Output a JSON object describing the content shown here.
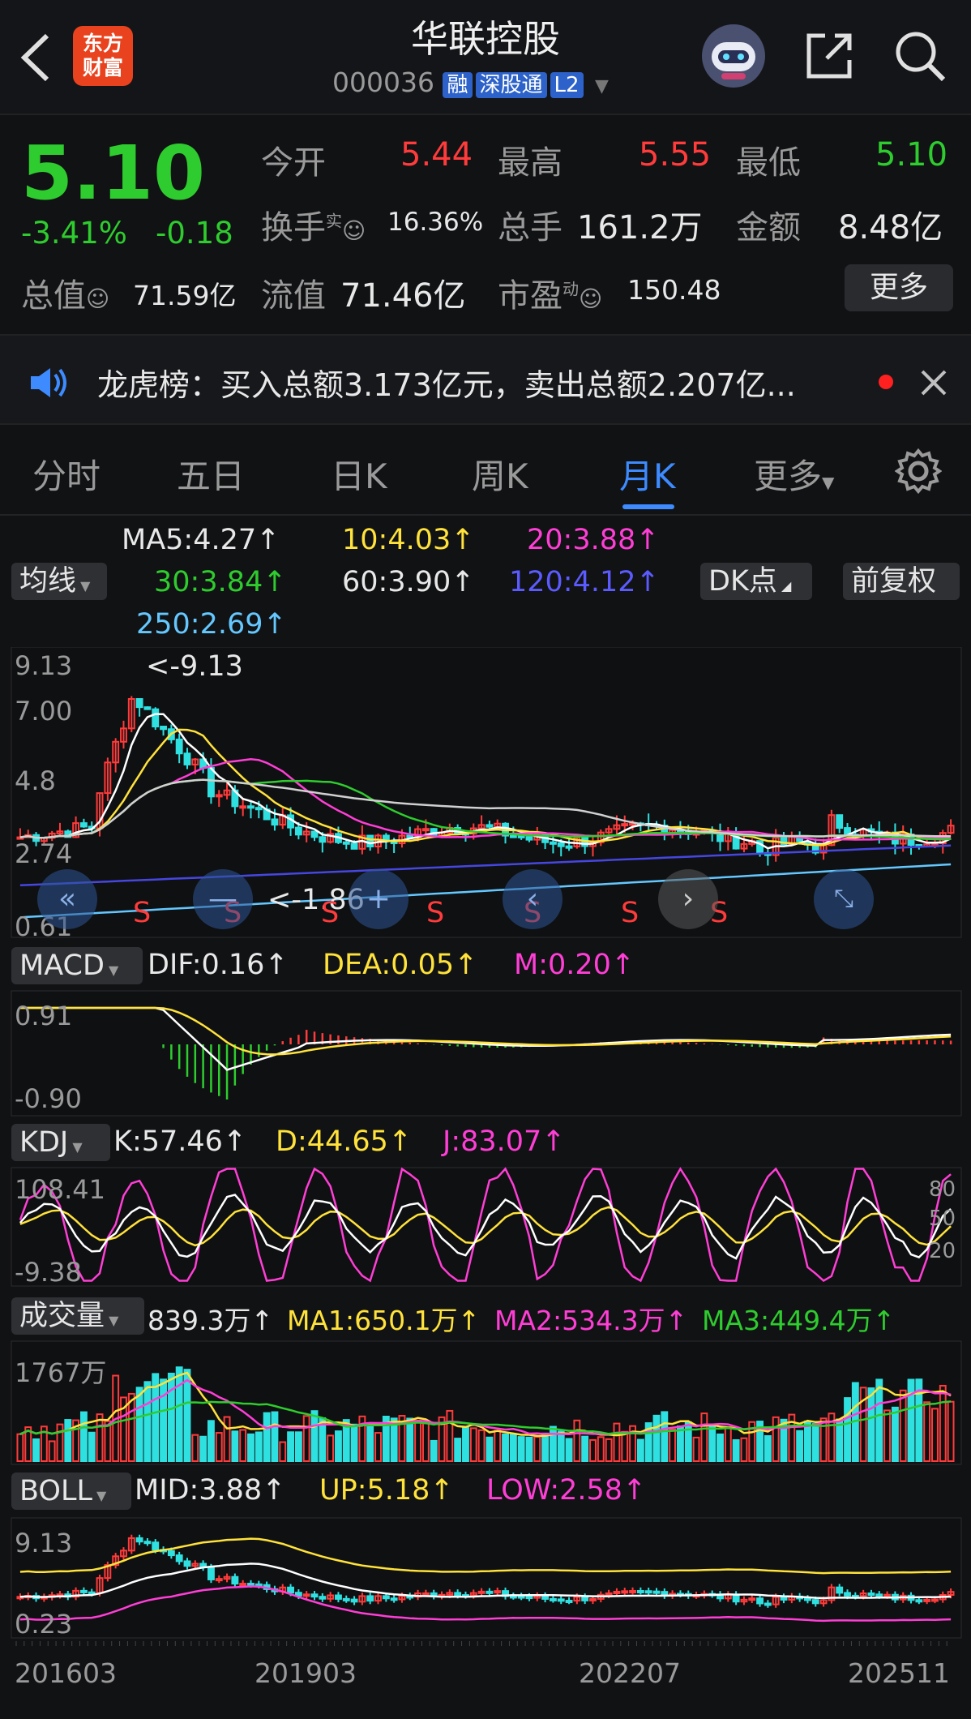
{
  "header": {
    "title": "华联控股",
    "code": "000036",
    "badges": [
      "融",
      "深股通",
      "L2"
    ],
    "logo_top": "东方",
    "logo_bottom": "财富"
  },
  "quote": {
    "price": "5.10",
    "change_pct": "-3.41%",
    "change": "-0.18",
    "open_label": "今开",
    "open": "5.44",
    "high_label": "最高",
    "high": "5.55",
    "low_label": "最低",
    "low": "5.10",
    "turnover_label": "换手",
    "turnover_sup": "实",
    "turnover": "16.36%",
    "volume_label": "总手",
    "volume": "161.2万",
    "amount_label": "金额",
    "amount": "8.48亿",
    "mktcap_label": "总值",
    "mktcap": "71.59亿",
    "float_label": "流值",
    "float_cap": "71.46亿",
    "pe_label": "市盈",
    "pe_sup": "动",
    "pe": "150.48",
    "more": "更多"
  },
  "notice": {
    "text": "龙虎榜：买入总额3.173亿元，卖出总额2.207亿..."
  },
  "tabs": {
    "items": [
      "分时",
      "五日",
      "日K",
      "周K",
      "月K",
      "更多"
    ],
    "active": "月K"
  },
  "ma": {
    "selector": "均线",
    "ma5": "MA5:4.27↑",
    "ma10": "10:4.03↑",
    "ma20": "20:3.88↑",
    "ma30": "30:3.84↑",
    "ma60": "60:3.90↑",
    "ma120": "120:4.12↑",
    "ma250": "250:2.69↑",
    "dk": "DK点",
    "fq": "前复权"
  },
  "kline": {
    "y_top": "9.13",
    "y_mid1": "7.00",
    "y_mid2": "4.8",
    "y_mid3": "2.74",
    "y_bot": "0.61",
    "max_label": "<-9.13",
    "min_label": "<-1.86",
    "signal": "S"
  },
  "macd": {
    "selector": "MACD",
    "dif": "DIF:0.16↑",
    "dea": "DEA:0.05↑",
    "m": "M:0.20↑",
    "y_top": "0.91",
    "y_bot": "-0.90"
  },
  "kdj": {
    "selector": "KDJ",
    "k": "K:57.46↑",
    "d": "D:44.65↑",
    "j": "J:83.07↑",
    "y_top": "108.41",
    "y_bot": "-9.38",
    "r80": "80",
    "r50": "50",
    "r20": "20"
  },
  "vol": {
    "selector": "成交量",
    "v": "839.3万↑",
    "ma1": "MA1:650.1万↑",
    "ma2": "MA2:534.3万↑",
    "ma3": "MA3:449.4万↑",
    "y_top": "1767万"
  },
  "boll": {
    "selector": "BOLL",
    "mid": "MID:3.88↑",
    "up": "UP:5.18↑",
    "low": "LOW:2.58↑",
    "y_top": "9.13",
    "y_bot": "0.23"
  },
  "xaxis": {
    "d1": "201603",
    "d2": "201903",
    "d3": "202207",
    "d4": "202511"
  },
  "colors": {
    "up": "#ff3b3b",
    "down": "#2fe0e0",
    "accent": "#3d8bff",
    "ma5": "#ffffff",
    "ma10": "#ffe23a",
    "ma20": "#ff3ed6",
    "ma30": "#2ecc2e",
    "ma60": "#d0d0d0",
    "ma120": "#4646e0",
    "ma250": "#64c8ff"
  }
}
